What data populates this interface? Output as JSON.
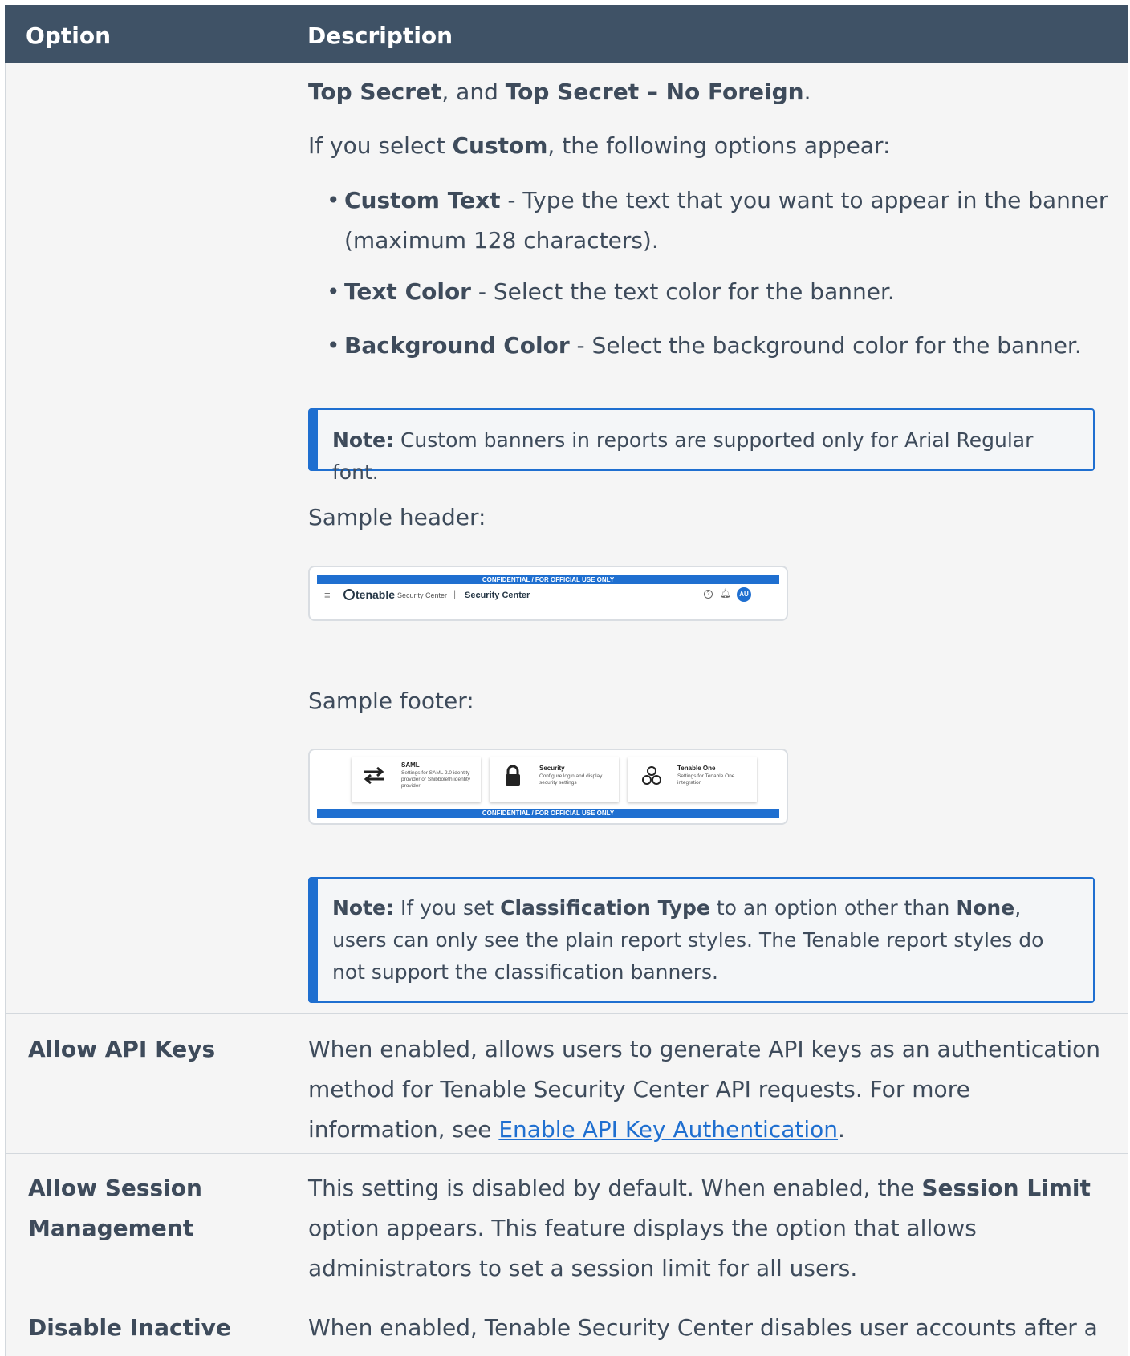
{
  "header": {
    "option": "Option",
    "description": "Description"
  },
  "classification": {
    "levels_tail": {
      "a": "Top Secret",
      "sep": ", and ",
      "b": "Top Secret – No Foreign",
      "end": "."
    },
    "custom_intro": {
      "pre": "If you select ",
      "bold": "Custom",
      "post": ", the following options appear:"
    },
    "bullets": [
      {
        "bold": "Custom Text",
        "text": " - Type the text that you want to appear in the banner (maximum 128 characters)."
      },
      {
        "bold": "Text Color",
        "text": " - Select the text color for the banner."
      },
      {
        "bold": "Background Color",
        "text": " - Select the background color for the banner."
      }
    ],
    "note1": {
      "label": "Note:",
      "text": " Custom banners in reports are supported only for Arial Regular font."
    },
    "sample_header_label": "Sample header:",
    "sample_footer_label": "Sample footer:",
    "note2": {
      "label": "Note:",
      "t1": " If you set ",
      "b1": "Classification Type",
      "t2": " to an option other than ",
      "b2": "None",
      "t3": ", users can only see the plain report styles. The Tenable report styles do not support the classification banners."
    }
  },
  "sample_header": {
    "banner": "CONFIDENTIAL / FOR OFFICIAL USE ONLY",
    "logo": "tenable",
    "product": "Security Center",
    "page_title": "Security Center",
    "avatar": "AU"
  },
  "sample_footer": {
    "banner": "CONFIDENTIAL / FOR OFFICIAL USE ONLY",
    "tiles": [
      {
        "title": "SAML",
        "desc": "Settings for SAML 2.0 identity provider or Shibboleth identity provider",
        "icon": "swap-arrows-icon"
      },
      {
        "title": "Security",
        "desc": "Configure login and display security settings",
        "icon": "lock-icon"
      },
      {
        "title": "Tenable One",
        "desc": "Settings for Tenable One integration",
        "icon": "hexagons-icon"
      }
    ]
  },
  "rows": [
    {
      "option": "Allow API Keys",
      "t1": "When enabled, allows users to generate API keys as an authentication method for Tenable Security Center API requests. For more information, see ",
      "link": "Enable API Key Authentication",
      "t2": "."
    },
    {
      "option": "Allow Session Management",
      "t1": "This setting is disabled by default. When enabled, the ",
      "bold": "Session Limit",
      "t2": " option appears. This feature displays the option that allows administrators to set a session limit for all users."
    },
    {
      "option": "Disable Inactive",
      "t1": "When enabled, Tenable Security Center disables user accounts after a"
    }
  ],
  "colors": {
    "header_bg": "#3f5266",
    "accent": "#1f6fd0",
    "body_bg": "#f5f5f5",
    "text": "#3e4b5b"
  }
}
